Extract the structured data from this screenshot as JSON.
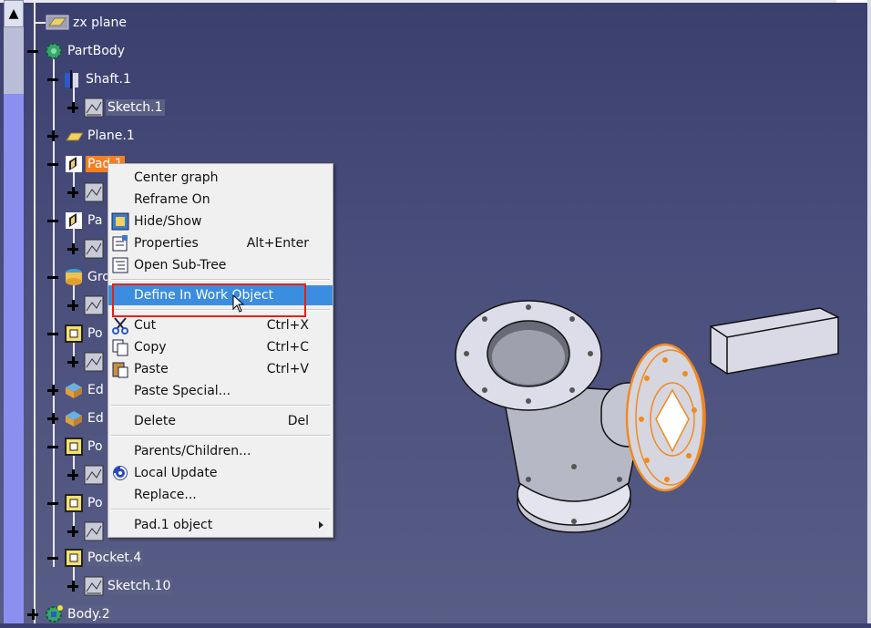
{
  "tree": {
    "nodes": [
      {
        "label": "zx plane",
        "icon": "plane-icon"
      },
      {
        "label": "PartBody",
        "icon": "partbody-gear-icon"
      },
      {
        "label": "Shaft.1",
        "icon": "shaft-icon"
      },
      {
        "label": "Sketch.1",
        "icon": "sketch-icon"
      },
      {
        "label": "Plane.1",
        "icon": "plane-icon"
      },
      {
        "label": "Pad.1",
        "icon": "pad-icon"
      },
      {
        "label": "Pa",
        "icon": "pad-icon"
      },
      {
        "label": "Gro",
        "icon": "groove-icon"
      },
      {
        "label": "Po",
        "icon": "pocket-icon"
      },
      {
        "label": "Ed",
        "icon": "edge-fillet-icon"
      },
      {
        "label": "Ed",
        "icon": "edge-fillet-icon"
      },
      {
        "label": "Po",
        "icon": "pocket-icon"
      },
      {
        "label": "Po",
        "icon": "pocket-icon"
      },
      {
        "label": "Pocket.4",
        "icon": "pocket-icon"
      },
      {
        "label": "Sketch.10",
        "icon": "sketch-icon"
      },
      {
        "label": "Body.2",
        "icon": "body-icon"
      }
    ]
  },
  "context_menu": {
    "items": [
      {
        "label": "Center graph",
        "shortcut": ""
      },
      {
        "label": "Reframe On",
        "shortcut": ""
      },
      {
        "label": "Hide/Show",
        "shortcut": "",
        "icon": "hide-show-icon"
      },
      {
        "label": "Properties",
        "shortcut": "Alt+Enter",
        "icon": "properties-icon"
      },
      {
        "label": "Open Sub-Tree",
        "shortcut": "",
        "icon": "subtree-icon"
      },
      {
        "label": "Define In Work Object",
        "shortcut": "",
        "highlighted": true
      },
      {
        "label": "Cut",
        "shortcut": "Ctrl+X",
        "icon": "scissors-icon"
      },
      {
        "label": "Copy",
        "shortcut": "Ctrl+C",
        "icon": "copy-icon"
      },
      {
        "label": "Paste",
        "shortcut": "Ctrl+V",
        "icon": "paste-icon"
      },
      {
        "label": "Paste Special...",
        "shortcut": ""
      },
      {
        "label": "Delete",
        "shortcut": "Del"
      },
      {
        "label": "Parents/Children...",
        "shortcut": ""
      },
      {
        "label": "Local Update",
        "shortcut": "",
        "icon": "local-update-icon"
      },
      {
        "label": "Replace...",
        "shortcut": ""
      },
      {
        "label": "Pad.1 object",
        "shortcut": "",
        "submenu": true
      }
    ]
  },
  "colors": {
    "selection": "#f57f1f",
    "menu_highlight": "#3b8de0",
    "callout": "#e5211c",
    "background": "#4a4f7c"
  }
}
